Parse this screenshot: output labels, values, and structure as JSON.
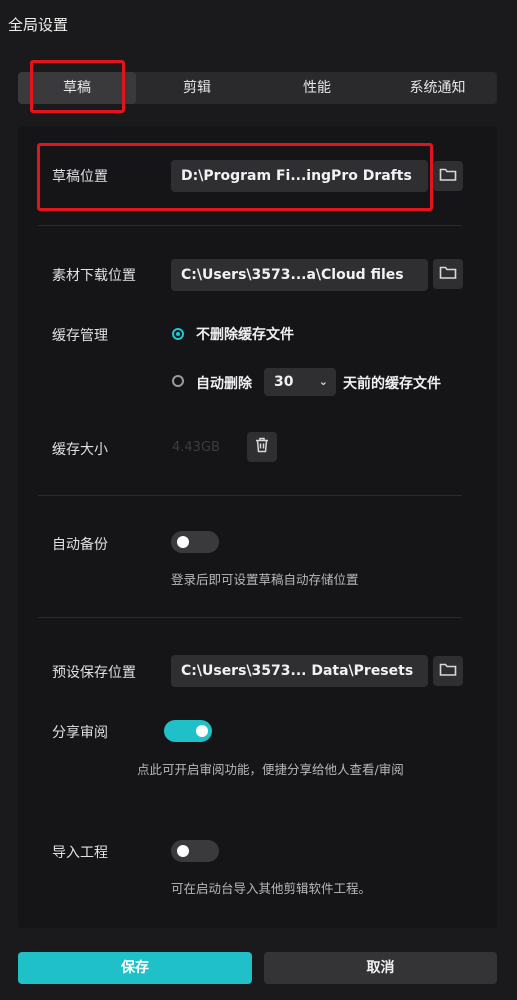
{
  "window": {
    "title": "全局设置"
  },
  "tabs": [
    {
      "label": "草稿",
      "active": true
    },
    {
      "label": "剪辑"
    },
    {
      "label": "性能"
    },
    {
      "label": "系统通知"
    }
  ],
  "draft_location": {
    "label": "草稿位置",
    "value": "D:\\Program Fi...ingPro Drafts",
    "icon": "folder-icon"
  },
  "download_location": {
    "label": "素材下载位置",
    "value": "C:\\Users\\3573...a\\Cloud files",
    "icon": "folder-icon"
  },
  "cache": {
    "label": "缓存管理",
    "option_keep": "不删除缓存文件",
    "option_auto_prefix": "自动删除",
    "days": "30",
    "option_auto_suffix": "天前的缓存文件",
    "selected": "keep"
  },
  "cache_size": {
    "label": "缓存大小",
    "value": "4.43GB",
    "icon": "trash-icon"
  },
  "auto_backup": {
    "label": "自动备份",
    "enabled": false,
    "hint": "登录后即可设置草稿自动存储位置"
  },
  "preset_location": {
    "label": "预设保存位置",
    "value": "C:\\Users\\3573... Data\\Presets",
    "icon": "folder-icon"
  },
  "share_review": {
    "label": "分享审阅",
    "enabled": true,
    "hint": "点此可开启审阅功能，便捷分享给他人查看/审阅"
  },
  "import_project": {
    "label": "导入工程",
    "enabled": false,
    "hint": "可在启动台导入其他剪辑软件工程。"
  },
  "footer": {
    "save_label": "保存",
    "cancel_label": "取消"
  },
  "colors": {
    "accent": "#1fc0c8",
    "highlight_box": "#e2141e",
    "background": "#1a1a1c"
  }
}
